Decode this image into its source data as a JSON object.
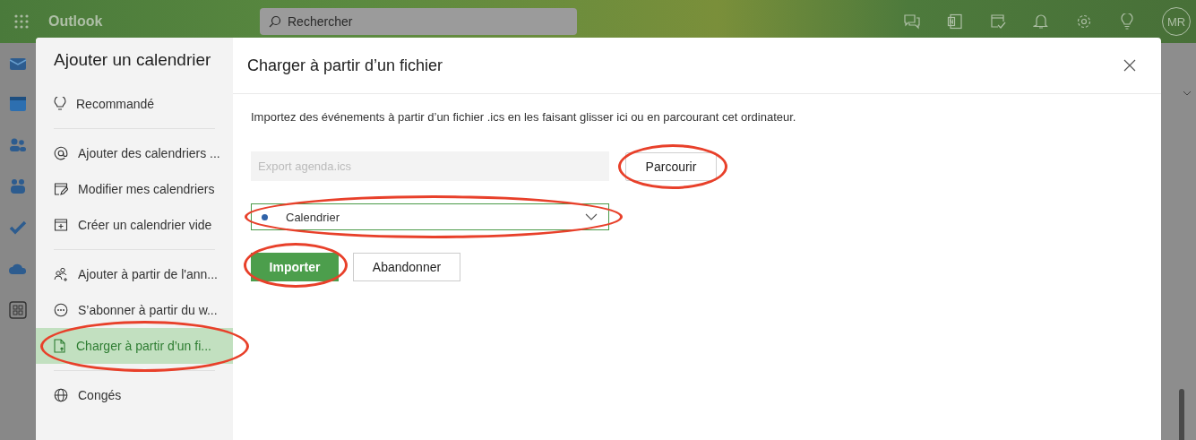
{
  "app": {
    "name": "Outlook",
    "search": {
      "placeholder": "Rechercher"
    },
    "avatar": "MR"
  },
  "dialog": {
    "title": "Ajouter un calendrier",
    "groups": [
      {
        "items": [
          {
            "label": "Recommandé",
            "selected": false,
            "circled": false
          }
        ]
      },
      {
        "items": [
          {
            "label": "Ajouter des calendriers ...",
            "selected": false,
            "circled": false
          },
          {
            "label": "Modifier mes calendriers",
            "selected": false,
            "circled": false
          },
          {
            "label": "Créer un calendrier vide",
            "selected": false,
            "circled": false
          }
        ]
      },
      {
        "items": [
          {
            "label": "Ajouter à partir de l'ann...",
            "selected": false,
            "circled": false
          },
          {
            "label": "S’abonner à partir du w...",
            "selected": false,
            "circled": false
          },
          {
            "label": "Charger à partir d’un fi...",
            "selected": true,
            "circled": true
          }
        ]
      },
      {
        "items": [
          {
            "label": "Congés",
            "selected": false,
            "circled": false
          }
        ]
      }
    ],
    "panel": {
      "title": "Charger à partir d’un fichier",
      "description": "Importez des événements à partir d’un fichier .ics en les faisant glisser ici ou en parcourant cet ordinateur.",
      "file_field": {
        "placeholder": "Export agenda.ics"
      },
      "browse_button": {
        "label": "Parcourir",
        "circled": true
      },
      "calendar_select": {
        "value": "Calendrier",
        "color": "#2f62a8",
        "circled": true
      },
      "buttons": [
        {
          "label": "Importer",
          "kind": "primary",
          "circled": true
        },
        {
          "label": "Abandonner",
          "kind": "secondary",
          "circled": false
        }
      ]
    }
  }
}
